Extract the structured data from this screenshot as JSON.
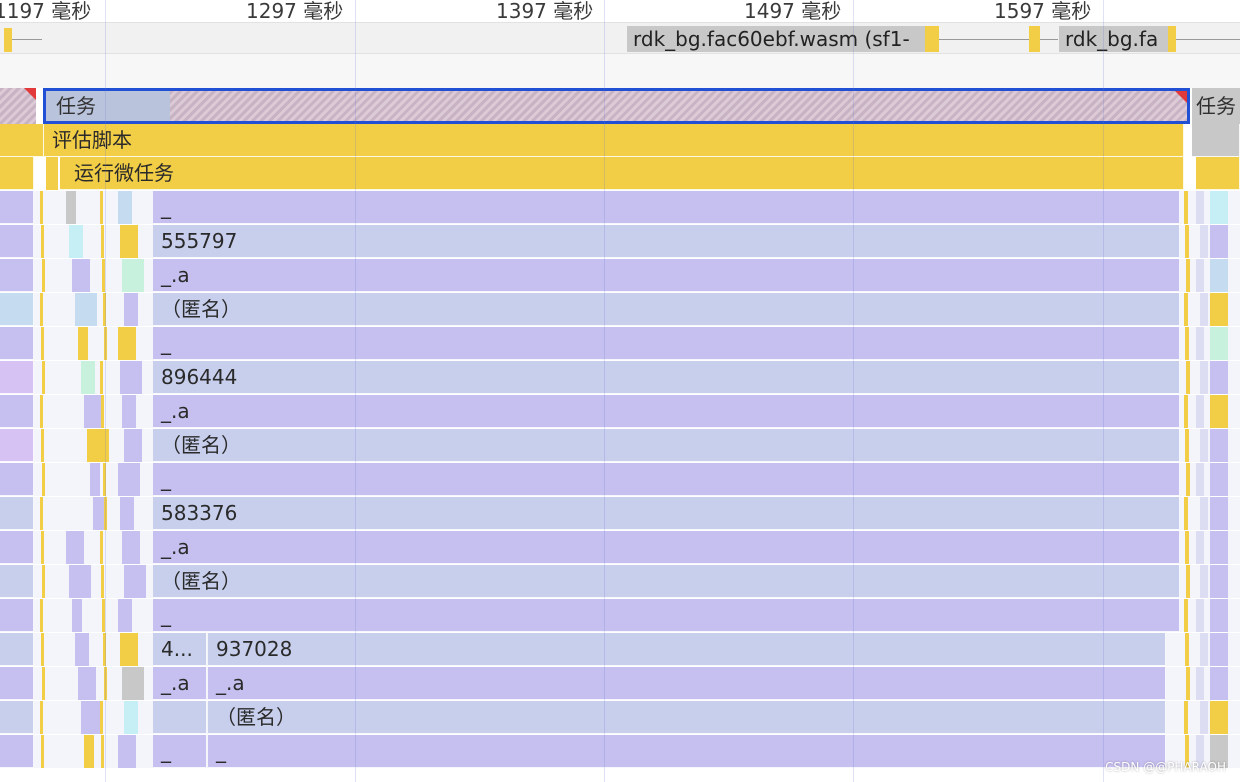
{
  "timeline": {
    "ticks": [
      "1197 毫秒",
      "1297 毫秒",
      "1397 毫秒",
      "1497 毫秒",
      "1597 毫秒"
    ]
  },
  "network": {
    "items": [
      "rdk_bg.fac60ebf.wasm (sf1-",
      "rdk_bg.fa"
    ]
  },
  "flame": {
    "task_label": "任务",
    "task_label_right": "任务",
    "evaluate_script": "评估脚本",
    "run_microtasks": "运行微任务",
    "rows": [
      [
        "_"
      ],
      [
        "555797"
      ],
      [
        "_.a"
      ],
      [
        "（匿名）"
      ],
      [
        "_"
      ],
      [
        "896444"
      ],
      [
        "_.a"
      ],
      [
        "（匿名）"
      ],
      [
        "_"
      ],
      [
        "583376"
      ],
      [
        "_.a"
      ],
      [
        "（匿名）"
      ],
      [
        "_"
      ],
      [
        "4...",
        "937028"
      ],
      [
        "_.a",
        "_.a"
      ],
      [
        "",
        "（匿名）"
      ],
      [
        "_",
        "_"
      ]
    ]
  },
  "watermark": "CSDN @@PHARAOH",
  "colors": {
    "task_selected_border": "#2150d4",
    "function_purple": "#c6c0f0",
    "function_bluegray": "#c7cfec",
    "script_yellow": "#f2cd46",
    "long_task_red": "#e23a3a"
  }
}
